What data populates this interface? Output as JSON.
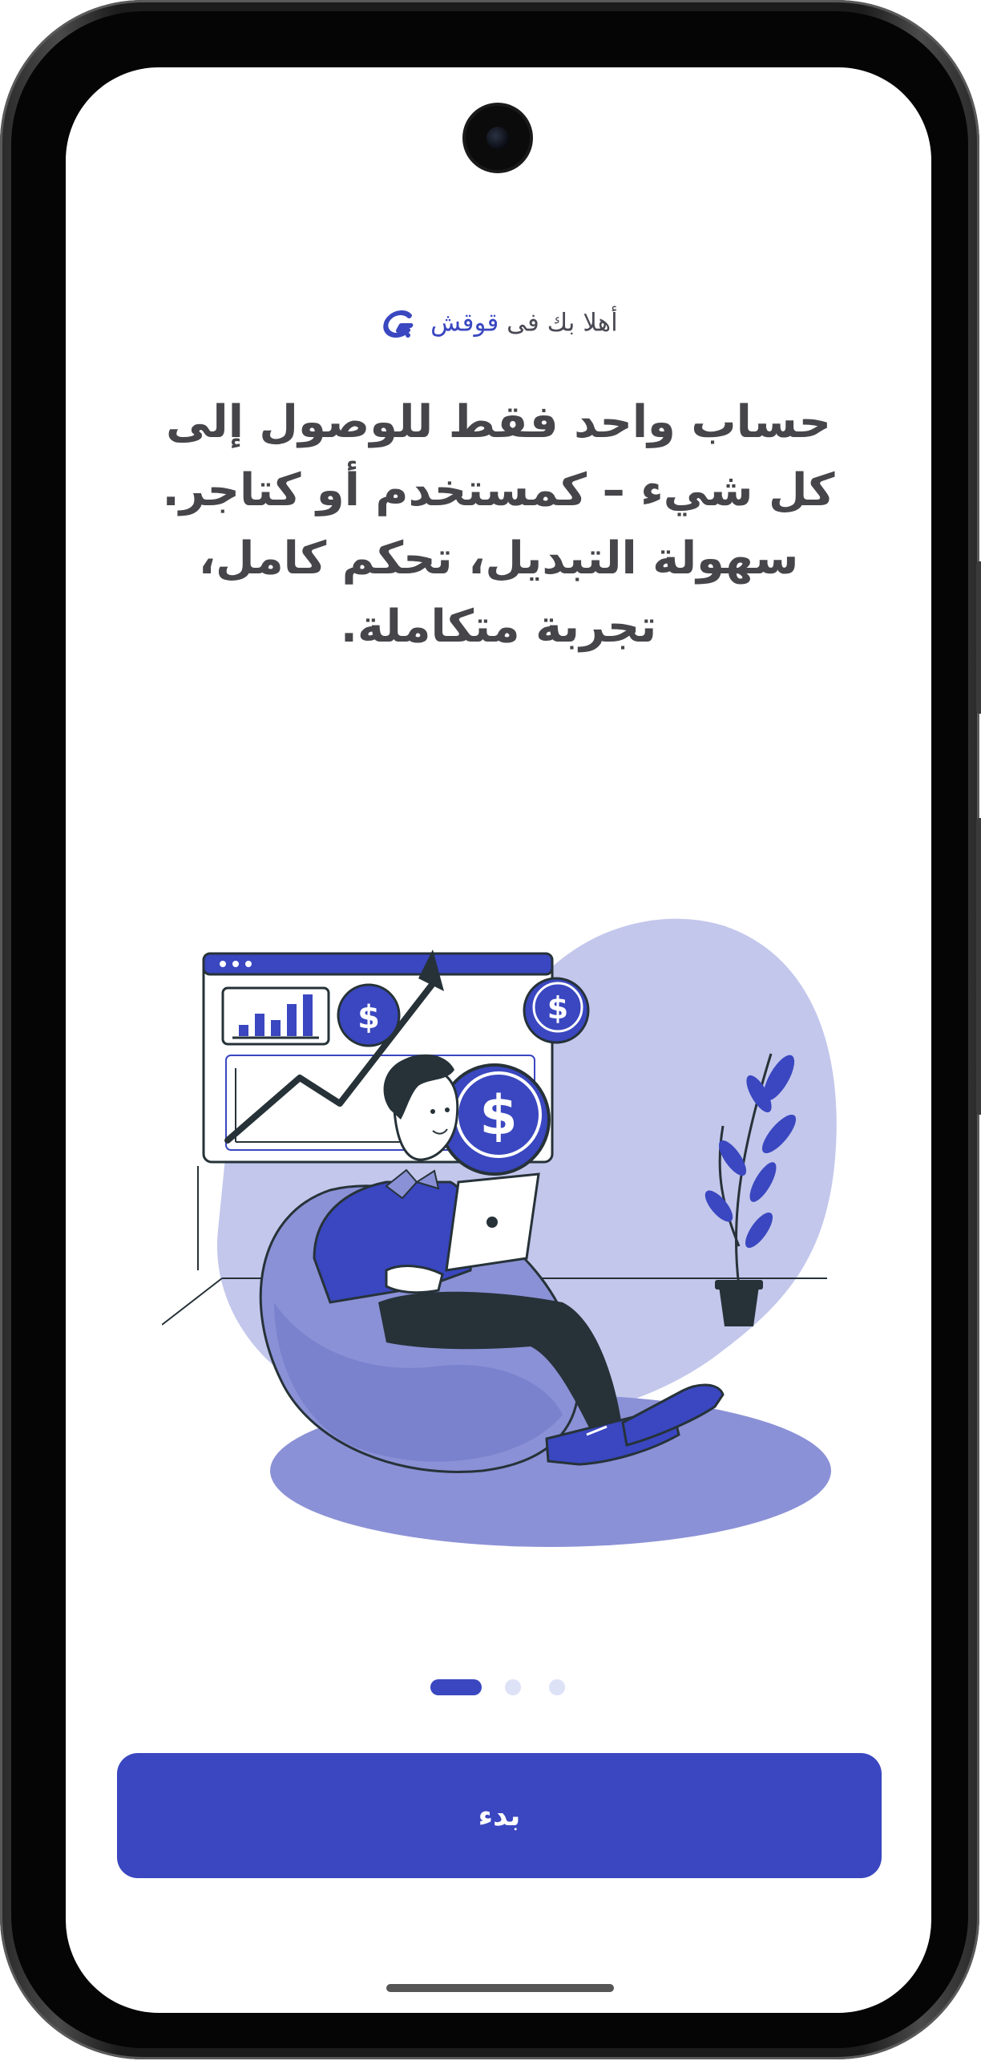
{
  "onboarding": {
    "welcome_prefix": "أهلا بك فى",
    "brand_name": "قوقش",
    "headline_lines": [
      "حساب واحد فقط للوصول إلى",
      "كل شيء – كمستخدم أو كتاجر.",
      "سهولة التبديل، تحكم كامل،",
      "تجربة متكاملة."
    ],
    "illustration": {
      "subject": "person-with-laptop-on-beanbag",
      "elements": [
        "growth-chart-window",
        "trend-arrow",
        "dollar-coin",
        "plant-pot",
        "beanbag-chair"
      ]
    },
    "pagination": {
      "total": 3,
      "active_index": 0
    },
    "cta_label": "بدء"
  },
  "colors": {
    "accent": "#3a47c0",
    "text_primary": "#45454a",
    "text_secondary": "#4a4a55",
    "dot_active": "#3a47c0",
    "dot_inactive": "#dde2f7",
    "illustration_light": "#c3c7ec",
    "illustration_mid": "#8b91d6",
    "illustration_dark": "#263238"
  }
}
